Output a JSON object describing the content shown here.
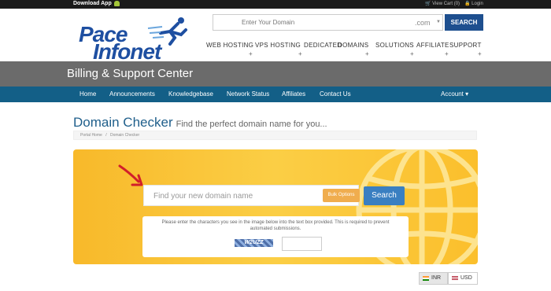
{
  "topbar": {
    "download_app": "Download App",
    "cart": "View Cart (0)",
    "login": "Login"
  },
  "logo": {
    "line1": "Pace",
    "line2": "Infonet",
    "tm": "TM"
  },
  "header_search": {
    "placeholder": "Enter Your Domain",
    "tld": ".com",
    "button": "SEARCH"
  },
  "main_nav": [
    "WEB HOSTING",
    "VPS HOSTING",
    "DEDICATED",
    "DOMAINS",
    "SOLUTIONS",
    "AFFILIATE",
    "SUPPORT"
  ],
  "band": {
    "title": "Billing & Support Center"
  },
  "navbar": {
    "items": [
      "Home",
      "Announcements",
      "Knowledgebase",
      "Network Status",
      "Affiliates",
      "Contact Us"
    ],
    "account": "Account"
  },
  "page": {
    "title": "Domain Checker",
    "subtitle": "Find the perfect domain name for you...",
    "breadcrumb": [
      "Portal Home",
      "Domain Checker"
    ]
  },
  "domain_search": {
    "placeholder": "Find your new domain name",
    "bulk_label": "Bulk Options",
    "search_label": "Search"
  },
  "captcha": {
    "message": "Please enter the characters you see in the image below into the text box provided. This is required to prevent automated submissions.",
    "code": "W2UZZ"
  },
  "currency": {
    "options": [
      "INR",
      "USD"
    ],
    "selected": "INR"
  },
  "colors": {
    "nav_blue": "#135f87",
    "panel_yellow": "#fbce45",
    "search_blue": "#3a7fc1",
    "bulk_orange": "#f0ad4e",
    "band_gray": "#6b6b6b"
  }
}
